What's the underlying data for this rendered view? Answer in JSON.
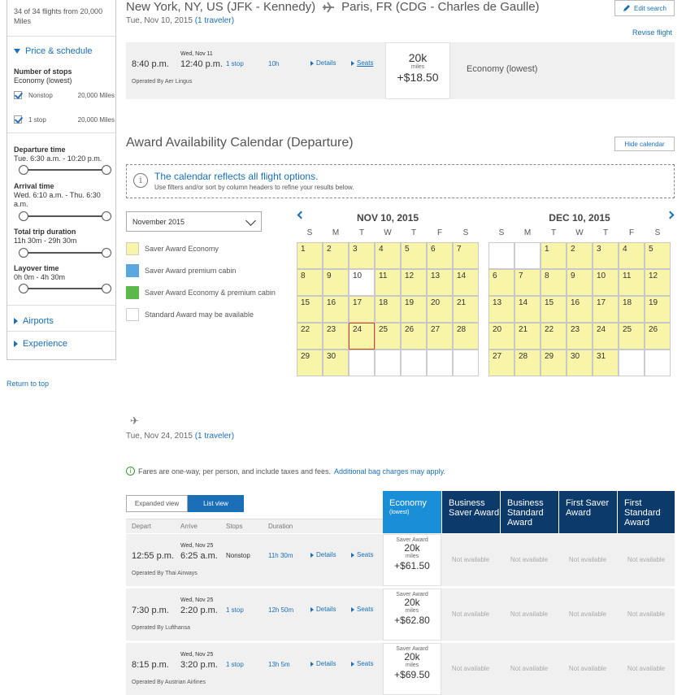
{
  "sidebar": {
    "count": "34 of 34 flights from 20,000 Miles",
    "price_schedule": "Price & schedule",
    "stops_label": "Number of stops",
    "stops_sub": "Economy (lowest)",
    "stops": [
      {
        "label": "Nonstop",
        "miles": "20,000 Miles"
      },
      {
        "label": "1 stop",
        "miles": "20,000 Miles"
      }
    ],
    "departure_label": "Departure time",
    "departure_range": "Tue. 6:30 a.m. - 10:20 p.m.",
    "arrival_label": "Arrival time",
    "arrival_range": "Wed. 6:10 a.m. - Thu. 6:30 a.m.",
    "duration_label": "Total trip duration",
    "duration_range": "11h 30m - 29h 30m",
    "layover_label": "Layover time",
    "layover_range": "0h 0m - 4h 30m",
    "airports": "Airports",
    "experience": "Experience",
    "return_top": "Return to top"
  },
  "outbound": {
    "origin": "New York, NY, US (JFK - Kennedy)",
    "destination": "Paris, FR (CDG - Charles de Gaulle)",
    "date": "Tue, Nov 10, 2015",
    "travelers": "(1 traveler)",
    "edit_search": "Edit search",
    "revise_flight": "Revise flight",
    "flight": {
      "depart": "8:40 p.m.",
      "arrive_day": "Wed, Nov 11",
      "arrive": "12:40 p.m.",
      "stops": "1 stop",
      "duration": "10h",
      "details": "Details",
      "seats": "Seats",
      "operated": "Operated By Aer Lingus",
      "miles": "20k",
      "miles_label": "miles",
      "taxes": "+$18.50",
      "cabin": "Economy (lowest)"
    }
  },
  "calendar": {
    "title": "Award Availability Calendar (Departure)",
    "hide": "Hide calendar",
    "notice_title": "The calendar reflects all flight options.",
    "notice_text": "Use filters and/or sort by column headers to refine your results below.",
    "month_select": "November 2015",
    "legend": [
      {
        "label": "Saver Award Economy",
        "color": "#f8f4a8"
      },
      {
        "label": "Saver Award premium cabin",
        "color": "#5aa6e0"
      },
      {
        "label": "Saver Award Economy & premium cabin",
        "color": "#5cb848"
      },
      {
        "label": "Standard Award may be available",
        "color": "#ffffff"
      }
    ],
    "weekdays": [
      "S",
      "M",
      "T",
      "W",
      "T",
      "F",
      "S"
    ],
    "month1": {
      "title": "NOV 10, 2015",
      "offset": 0,
      "days": 30,
      "saver": [
        1,
        2,
        3,
        4,
        5,
        6,
        7,
        8,
        9,
        11,
        12,
        13,
        14,
        15,
        16,
        17,
        18,
        19,
        20,
        21,
        22,
        23,
        24,
        25,
        26,
        27,
        28,
        29,
        30
      ],
      "blank": [
        10
      ],
      "today": 24
    },
    "month2": {
      "title": "DEC 10, 2015",
      "offset": 2,
      "days": 31,
      "saver": [
        1,
        2,
        3,
        4,
        5,
        6,
        7,
        8,
        9,
        10,
        11,
        12,
        13,
        14,
        15,
        16,
        17,
        18,
        19,
        20,
        21,
        22,
        23,
        24,
        25,
        26,
        27,
        28,
        29,
        30,
        31
      ],
      "blank": []
    }
  },
  "return": {
    "date": "Tue, Nov 24, 2015",
    "travelers": "(1 traveler)",
    "fare_note": "Fares are one-way, per person, and include taxes and fees.",
    "bag_link": "Additional bag charges may apply.",
    "expanded_view": "Expanded view",
    "list_view": "List view",
    "columns": {
      "economy": "Economy",
      "economy_sub": "(lowest)",
      "business_saver": "Business Saver Award",
      "business_standard": "Business Standard Award",
      "first_saver": "First Saver Award",
      "first_standard": "First Standard Award"
    },
    "list_headers": {
      "depart": "Depart",
      "arrive": "Arrive",
      "stops": "Stops",
      "duration": "Duration"
    },
    "not_available": "Not available",
    "award_label": "Saver Award",
    "miles_label": "miles",
    "details": "Details",
    "seats": "Seats",
    "flights": [
      {
        "depart": "12:55 p.m.",
        "arrive_day": "Wed, Nov 25",
        "arrive": "6:25 a.m.",
        "stops": "Nonstop",
        "duration": "11h 30m",
        "operated": "Operated By Thai Airways",
        "miles": "20k",
        "taxes": "+$61.50"
      },
      {
        "depart": "7:30 p.m.",
        "arrive_day": "Wed, Nov 25",
        "arrive": "2:20 p.m.",
        "stops": "1 stop",
        "duration": "12h 50m",
        "operated": "Operated By Lufthansa",
        "miles": "20k",
        "taxes": "+$62.80"
      },
      {
        "depart": "8:15 p.m.",
        "arrive_day": "Wed, Nov 25",
        "arrive": "3:20 p.m.",
        "stops": "1 stop",
        "duration": "13h 5m",
        "operated": "Operated By Austrian Airlines",
        "miles": "20k",
        "taxes": "+$69.50"
      }
    ]
  }
}
